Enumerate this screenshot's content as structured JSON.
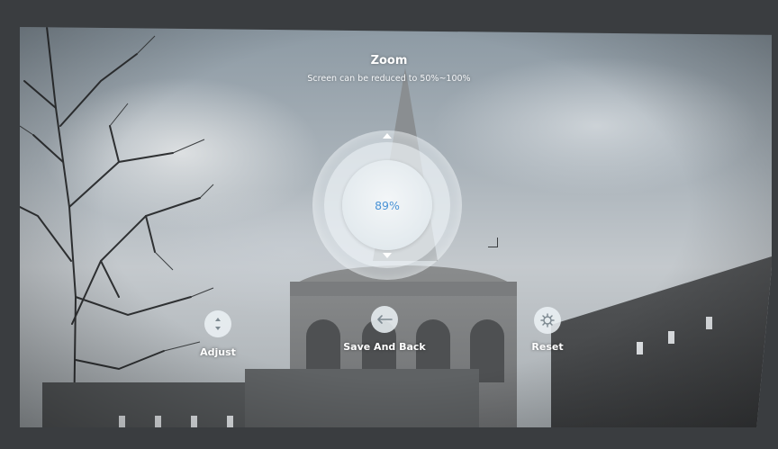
{
  "zoom_menu": {
    "title": "Zoom",
    "subtitle": "Screen can be reduced to 50%~100%",
    "value": "89%",
    "value_fraction": 0.89
  },
  "actions": {
    "adjust": {
      "label": "Adjust",
      "icon": "up-down-arrows-icon"
    },
    "save_and_back": {
      "label": "Save And Back",
      "icon": "back-arrow-icon"
    },
    "reset": {
      "label": "Reset",
      "icon": "reset-gear-icon"
    }
  },
  "colors": {
    "value_text": "#4a93d6",
    "dial_fill": "#e3eaee",
    "label_text": "#ffffff"
  }
}
